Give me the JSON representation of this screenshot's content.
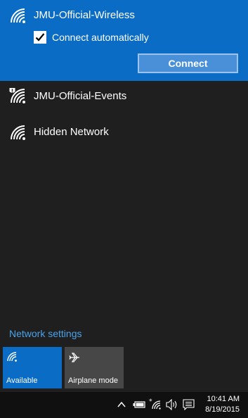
{
  "networks": [
    {
      "name": "JMU-Official-Wireless",
      "selected": true,
      "secured": false
    },
    {
      "name": "JMU-Official-Events",
      "selected": false,
      "secured": true
    },
    {
      "name": "Hidden Network",
      "selected": false,
      "secured": false
    }
  ],
  "connect_automatically": {
    "label": "Connect automatically",
    "checked": true
  },
  "connect_button": "Connect",
  "network_settings_link": "Network settings",
  "quick_actions": [
    {
      "label": "Available",
      "icon": "wifi-icon",
      "active": true
    },
    {
      "label": "Airplane mode",
      "icon": "airplane-icon",
      "active": false
    }
  ],
  "taskbar": {
    "time": "10:41 AM",
    "date": "8/19/2015",
    "tray_icons": [
      "chevron-up-icon",
      "battery-icon",
      "wifi-icon",
      "volume-icon",
      "action-center-icon"
    ]
  },
  "colors": {
    "accent": "#0a6cc4",
    "link": "#4aa3ea",
    "flyout_bg": "#1f1f1f",
    "taskbar_bg": "#101010"
  }
}
